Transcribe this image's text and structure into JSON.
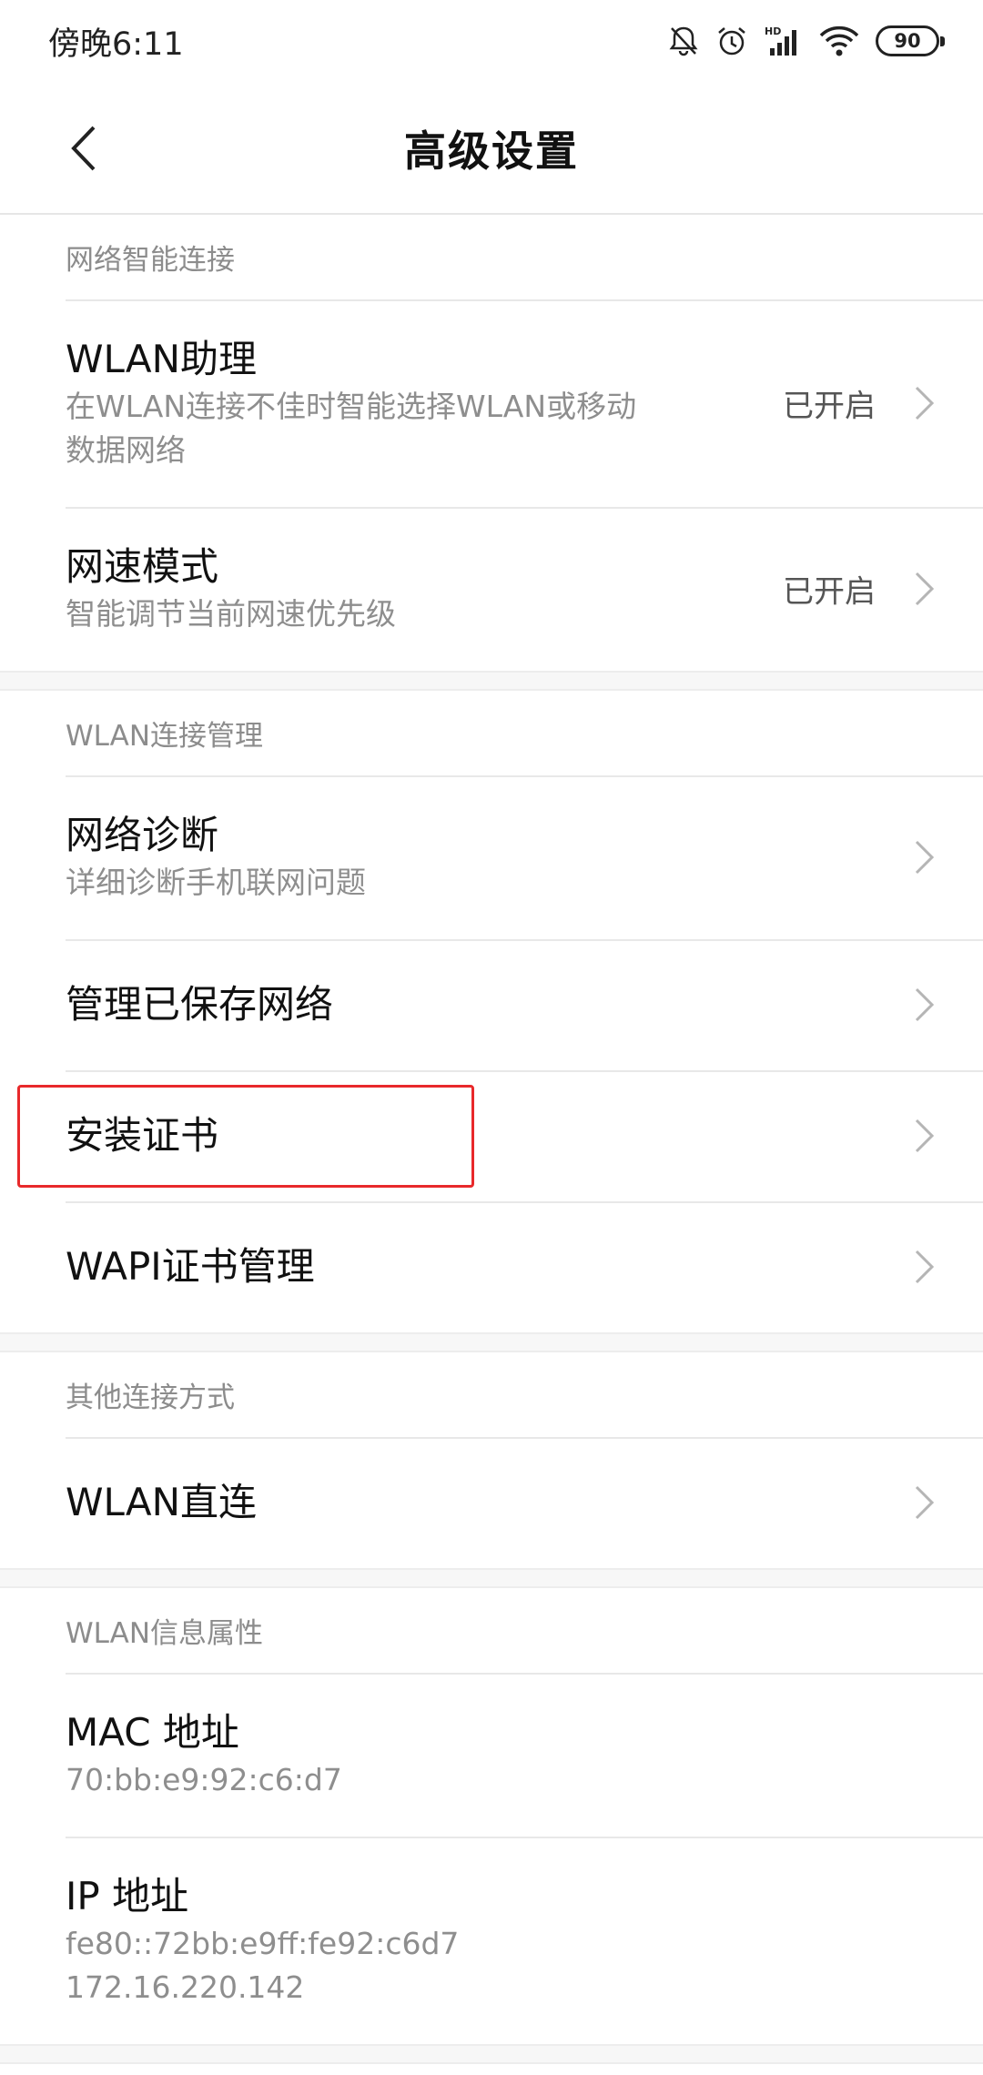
{
  "status_bar": {
    "time": "傍晚6:11",
    "icons": [
      "mute-bell-icon",
      "alarm-icon",
      "hd-signal-icon",
      "wifi-icon"
    ],
    "battery": "90"
  },
  "header": {
    "title": "高级设置",
    "back_icon": "chevron-left-icon"
  },
  "sections": [
    {
      "header": "网络智能连接",
      "items": [
        {
          "title": "WLAN助理",
          "subtitle": "在WLAN连接不佳时智能选择WLAN或移动数据网络",
          "value": "已开启"
        },
        {
          "title": "网速模式",
          "subtitle": "智能调节当前网速优先级",
          "value": "已开启"
        }
      ]
    },
    {
      "header": "WLAN连接管理",
      "items": [
        {
          "title": "网络诊断",
          "subtitle": "详细诊断手机联网问题"
        },
        {
          "title": "管理已保存网络"
        },
        {
          "title": "安装证书"
        },
        {
          "title": "WAPI证书管理"
        }
      ]
    },
    {
      "header": "其他连接方式",
      "items": [
        {
          "title": "WLAN直连"
        }
      ]
    },
    {
      "header": "WLAN信息属性",
      "items": [
        {
          "title": "MAC 地址",
          "subtitle": "70:bb:e9:92:c6:d7"
        },
        {
          "title": "IP 地址",
          "subtitle": "fe80::72bb:e9ff:fe92:c6d7",
          "subtitle2": "172.16.220.142"
        }
      ]
    }
  ],
  "colors": {
    "highlight": "#e8292b",
    "secondary_text": "#8e8e8e"
  }
}
